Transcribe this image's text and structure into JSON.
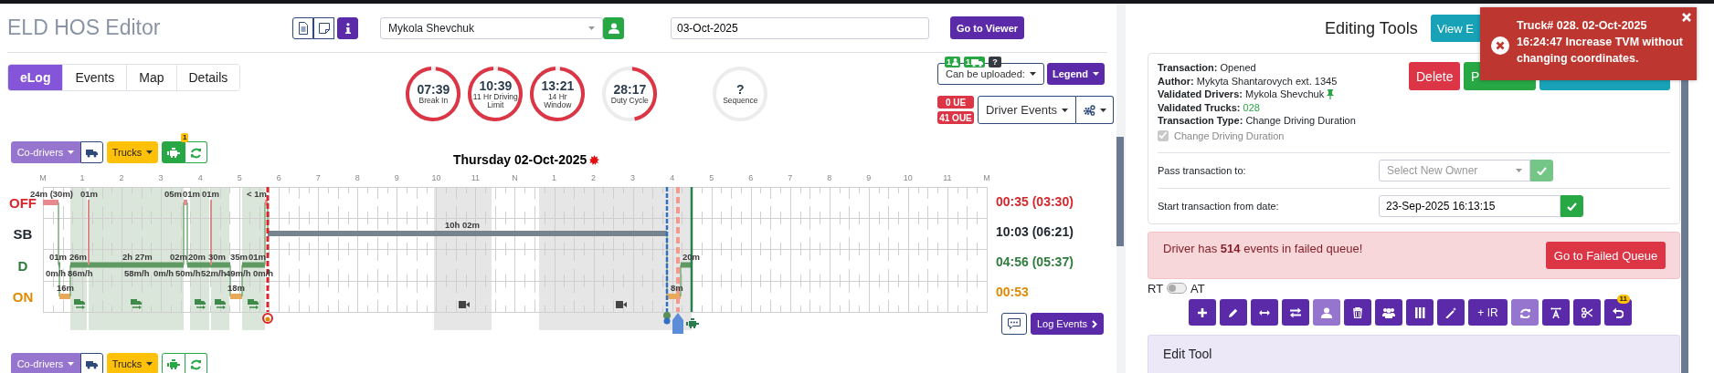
{
  "app_title": "ELD HOS Editor",
  "driver_select": {
    "value": "Mykola Shevchuk"
  },
  "date_field": {
    "value": "03-Oct-2025"
  },
  "go_to_viewer": "Go to Viewer",
  "tabs": [
    {
      "label": "eLog",
      "selected": true
    },
    {
      "label": "Events",
      "selected": false
    },
    {
      "label": "Map",
      "selected": false
    },
    {
      "label": "Details",
      "selected": false
    }
  ],
  "gauges": [
    {
      "value": "07:39",
      "label": "Break In",
      "level": 0.97
    },
    {
      "value": "10:39",
      "label": "11 Hr Driving Limit",
      "level": 0.97
    },
    {
      "value": "13:21",
      "label": "14 Hr Window",
      "level": 0.97
    },
    {
      "value": "28:17",
      "label": "Duty Cycle",
      "level": 0.45
    },
    {
      "value": "?",
      "label": "Sequence"
    }
  ],
  "upload_badges": [
    {
      "kind": "drivers",
      "text": "1"
    },
    {
      "kind": "trucks",
      "text": "1"
    },
    {
      "kind": "help",
      "text": "?"
    }
  ],
  "upload_dropdown": "Can be uploaded:",
  "legend_button": "Legend",
  "error_badges": [
    "0 UE",
    "41 OUE"
  ],
  "events_dropdown": "Driver Events",
  "toolbars": [
    {
      "codrivers": "Co-drivers",
      "trucks": "Trucks",
      "engine_on": true,
      "engine_badge": "1"
    },
    {
      "codrivers": "Co-drivers",
      "trucks": "Trucks",
      "engine_on": false
    }
  ],
  "log": {
    "title": "Thursday 02-Oct-2025",
    "chart": {
      "hours": [
        "M",
        "1",
        "2",
        "3",
        "4",
        "5",
        "6",
        "7",
        "8",
        "9",
        "10",
        "11",
        "N",
        "1",
        "2",
        "3",
        "4",
        "5",
        "6",
        "7",
        "8",
        "9",
        "10",
        "11",
        "M"
      ],
      "statuses": [
        {
          "label": "OFF",
          "total": "00:35 (03:30)",
          "color": "#d9262b"
        },
        {
          "label": "SB",
          "total": "10:03 (06:21)",
          "color": "#1f2630"
        },
        {
          "label": "D",
          "total": "04:56 (05:37)",
          "color": "#2e7d3c"
        },
        {
          "label": "ON",
          "total": "00:53",
          "color": "#e08a00"
        }
      ],
      "duration_labels": [
        "24m (30m)",
        "01m",
        "05m",
        "01m",
        "01m",
        "< 1m",
        "10h 02m",
        "01m",
        "26m",
        "2h 27m",
        "02m",
        "20m",
        "30m",
        "35m",
        "01m",
        "20m",
        "16m",
        "18m",
        "8m"
      ],
      "speed_labels": [
        "0m/h",
        "86m/h",
        "58m/h",
        "0m/h",
        "50m/h",
        "52m/h",
        "49m/h",
        "0m/h"
      ]
    }
  },
  "log_events_button": "Log Events",
  "panel_title": "Editing Tools",
  "view_button": "View E",
  "transaction": {
    "fields": [
      {
        "label": "Transaction:",
        "value": "Opened"
      },
      {
        "label": "Author:",
        "value": "Mykyta Shantarovych ext. 1345"
      },
      {
        "label": "Validated Drivers:",
        "value": "Mykola Shevchuk",
        "pinned": true
      },
      {
        "label": "Validated Trucks:",
        "value": "028",
        "kind": "link"
      },
      {
        "label": "Transaction Type:",
        "value": "Change Driving Duration"
      }
    ],
    "option": {
      "label": "Change Driving Duration",
      "checked": true,
      "disabled": true
    }
  },
  "action_buttons": [
    {
      "kind": "danger",
      "label": "Delete"
    },
    {
      "kind": "success",
      "label": "P"
    },
    {
      "kind": "info"
    }
  ],
  "pass_to": {
    "label": "Pass transaction to:",
    "placeholder": "Select New Owner"
  },
  "start_from": {
    "label": "Start transaction from date:",
    "value": "23-Sep-2025 16:13:15"
  },
  "alert": {
    "text": "Driver has **514** events in failed queue!",
    "button": "Go to Failed Queue"
  },
  "mode_toggle": {
    "left": "RT",
    "right": "AT",
    "on": false
  },
  "tools": [
    {
      "kind": "add",
      "disabled": false
    },
    {
      "kind": "edit",
      "disabled": false
    },
    {
      "kind": "stretch",
      "disabled": false
    },
    {
      "kind": "swap",
      "disabled": false
    },
    {
      "kind": "driver",
      "disabled": true
    },
    {
      "kind": "delete",
      "disabled": false
    },
    {
      "kind": "group",
      "disabled": false
    },
    {
      "kind": "columns",
      "disabled": false
    },
    {
      "kind": "wand",
      "disabled": false
    },
    {
      "kind": "ir",
      "label": "+ IR",
      "disabled": false
    },
    {
      "kind": "refresh",
      "disabled": true
    },
    {
      "kind": "text-width",
      "disabled": false
    },
    {
      "kind": "cut",
      "disabled": false
    },
    {
      "kind": "undo",
      "badge": "11",
      "disabled": false
    }
  ],
  "edit_tool": "Edit Tool",
  "toast": {
    "text": "Truck# 028. 02-Oct-2025 16:24:47 Increase TVM without changing coordinates."
  }
}
